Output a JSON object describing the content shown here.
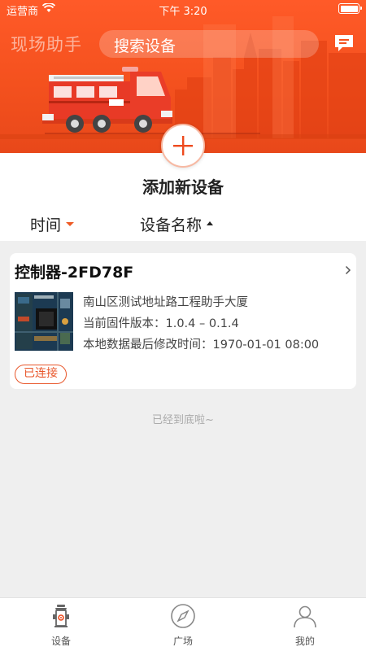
{
  "status_bar": {
    "carrier": "运营商",
    "time": "下午 3:20"
  },
  "header": {
    "app_name": "现场助手",
    "search_placeholder": "搜索设备"
  },
  "add_device": {
    "label": "添加新设备"
  },
  "sort": {
    "time_label": "时间",
    "name_label": "设备名称"
  },
  "devices": [
    {
      "name": "控制器-2FD78F",
      "address": "南山区测试地址路工程助手大厦",
      "firmware": "当前固件版本：1.0.4 – 0.1.4",
      "modified": "本地数据最后修改时间：1970-01-01 08:00",
      "status": "已连接"
    }
  ],
  "list_end": "已经到底啦~",
  "tabs": [
    {
      "label": "设备",
      "icon": "hydrant-icon",
      "active": true
    },
    {
      "label": "广场",
      "icon": "compass-icon",
      "active": false
    },
    {
      "label": "我的",
      "icon": "person-icon",
      "active": false
    }
  ],
  "colors": {
    "accent": "#f4511e",
    "accent_light": "#f7b9a3"
  }
}
